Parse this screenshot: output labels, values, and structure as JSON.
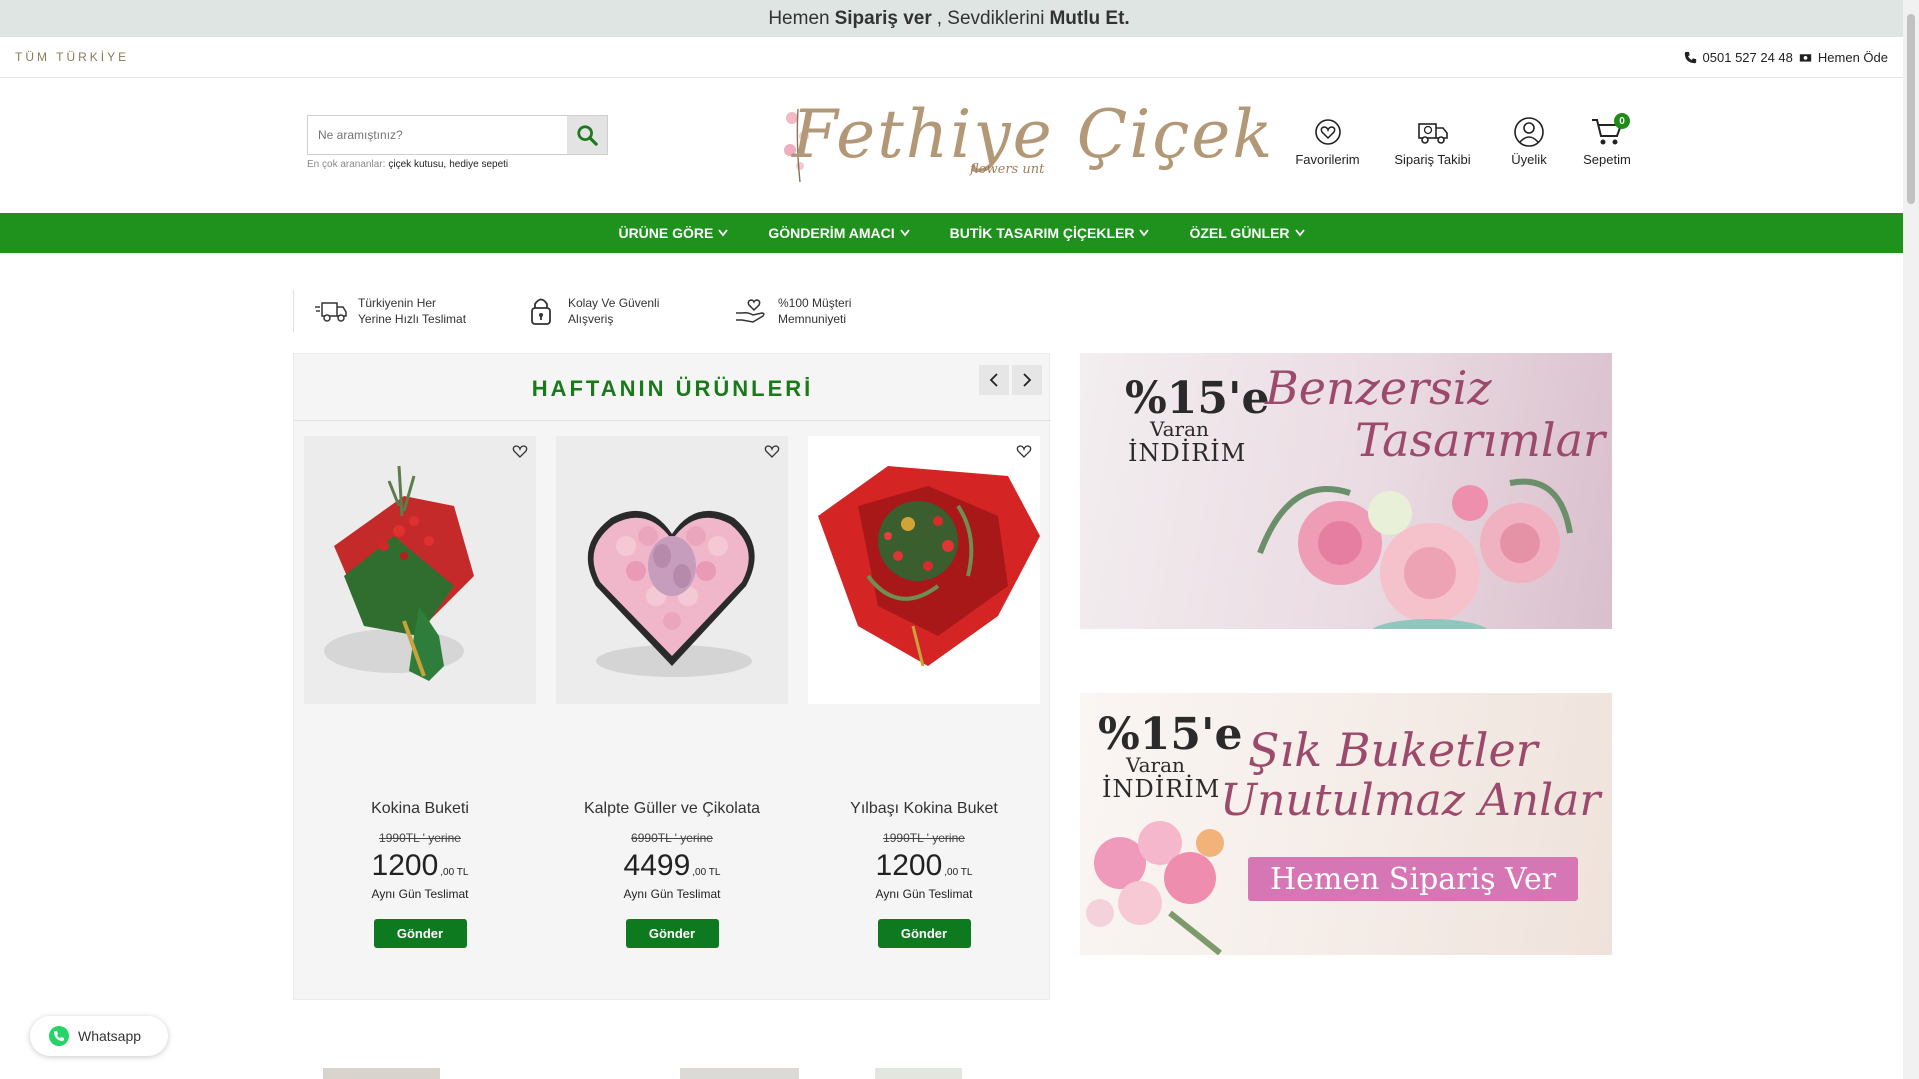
{
  "promo": {
    "pre": "Hemen",
    "b1": "Sipariş ver",
    "mid": ", Sevdiklerini",
    "b2": "Mutlu Et."
  },
  "topbar": {
    "region": "TÜM TÜRKİYE",
    "phone": "0501 527 24 48",
    "pay": "Hemen Öde"
  },
  "search": {
    "placeholder": "Ne aramıştınız?",
    "popular_label": "En çok arananlar:",
    "popular": [
      "çiçek kutusu,",
      "hediye sepeti"
    ]
  },
  "logo": {
    "main": "Fethiye Çiçek",
    "tag": "flowers unt"
  },
  "header_icons": {
    "favorites": "Favorilerim",
    "order_tracking": "Sipariş Takibi",
    "membership": "Üyelik",
    "cart": "Sepetim",
    "cart_count": "0"
  },
  "nav": [
    "ÜRÜNE GÖRE",
    "GÖNDERİM AMACI",
    "BUTİK TASARIM ÇİÇEKLER",
    "ÖZEL GÜNLER"
  ],
  "features": [
    {
      "line1": "Türkiyenin Her",
      "line2": "Yerine Hızlı Teslimat",
      "icon": "truck-icon"
    },
    {
      "line1": "Kolay Ve Güvenli",
      "line2": "Alışveriş",
      "icon": "lock-icon"
    },
    {
      "line1": "%100 Müşteri",
      "line2": "Memnuniyeti",
      "icon": "heart-hand-icon"
    }
  ],
  "weekly": {
    "title": "HAFTANIN ÜRÜNLERİ",
    "products": [
      {
        "name": "Kokina Buketi",
        "old_price": "1990TL ' yerine",
        "price": "1200",
        "cents": ",00 TL",
        "delivery": "Aynı Gün Teslimat",
        "button": "Gönder"
      },
      {
        "name": "Kalpte Güller ve Çikolata",
        "old_price": "6990TL ' yerine",
        "price": "4499",
        "cents": ",00 TL",
        "delivery": "Aynı Gün Teslimat",
        "button": "Gönder"
      },
      {
        "name": "Yılbaşı Kokina Buket",
        "old_price": "1990TL ' yerine",
        "price": "1200",
        "cents": ",00 TL",
        "delivery": "Aynı Gün Teslimat",
        "button": "Gönder"
      }
    ]
  },
  "banners": [
    {
      "pct": "%15'e",
      "varan": "Varan",
      "indirim": "İNDİRİM",
      "script1": "Benzersiz",
      "script2": "Tasarımlar"
    },
    {
      "pct": "%15'e",
      "varan": "Varan",
      "indirim": "İNDİRİM",
      "script1": "Şık Buketler",
      "script2": "Unutulmaz Anlar",
      "cta": "Hemen Sipariş Ver"
    }
  ],
  "whatsapp": {
    "label": "Whatsapp"
  },
  "colors": {
    "nav_green": "#1f921e",
    "button_green": "#0d7a1f",
    "title_green": "#1a7a1a",
    "promo_bg": "#dfe5e2",
    "banner_pink": "#d776b4"
  }
}
